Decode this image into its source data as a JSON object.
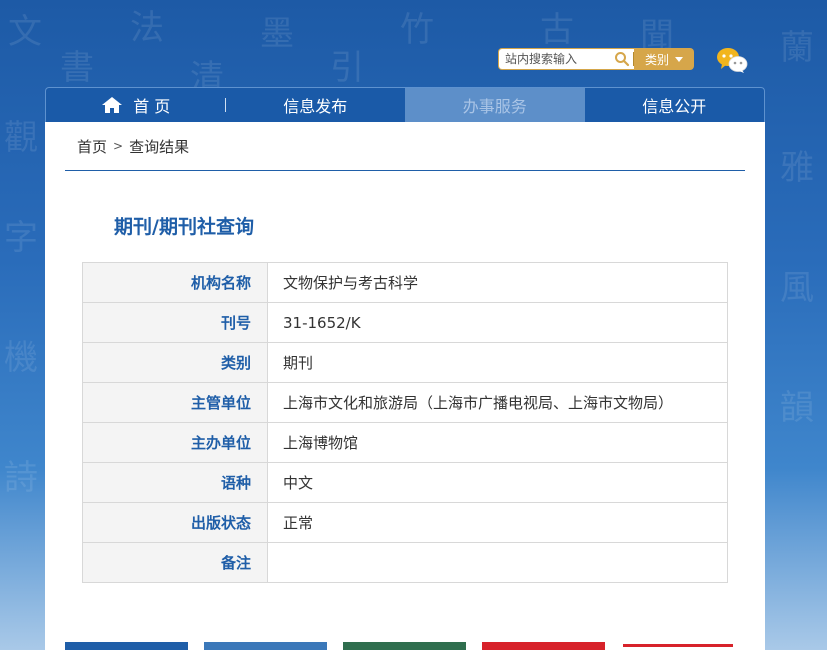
{
  "search": {
    "placeholder": "站内搜索输入",
    "category_label": "类别"
  },
  "icons": {
    "search": "search-icon",
    "wechat": "wechat-icon",
    "home": "home-icon",
    "dropdown": "chevron-down-icon"
  },
  "nav": {
    "items": [
      {
        "label": "首 页"
      },
      {
        "label": "信息发布"
      },
      {
        "label": "办事服务"
      },
      {
        "label": "信息公开"
      }
    ]
  },
  "breadcrumb": {
    "home": "首页",
    "separator": ">",
    "current": "查询结果"
  },
  "page_title": "期刊/期刊社查询",
  "details": [
    {
      "label": "机构名称",
      "value": "文物保护与考古科学"
    },
    {
      "label": "刊号",
      "value": "31-1652/K"
    },
    {
      "label": "类别",
      "value": "期刊"
    },
    {
      "label": "主管单位",
      "value": "上海市文化和旅游局（上海市广播电视局、上海市文物局）"
    },
    {
      "label": "主办单位",
      "value": "上海博物馆"
    },
    {
      "label": "语种",
      "value": "中文"
    },
    {
      "label": "出版状态",
      "value": "正常"
    },
    {
      "label": "备注",
      "value": ""
    }
  ],
  "colors": {
    "brand_blue": "#1f5ea8",
    "accent_gold": "#d6a64a",
    "nav_active": "#5d8fc9"
  }
}
